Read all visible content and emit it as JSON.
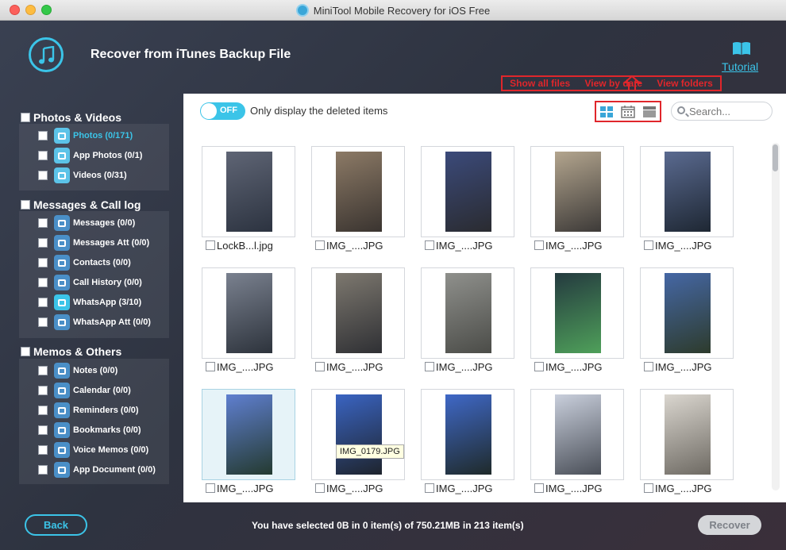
{
  "window": {
    "title": "MiniTool Mobile Recovery for iOS Free"
  },
  "header": {
    "title": "Recover from iTunes Backup File",
    "tutorial_label": "Tutorial",
    "view_tip": {
      "show_all": "Show all files",
      "by_date": "View by date",
      "folders": "View folders"
    }
  },
  "sidebar": {
    "categories": [
      {
        "label": "Photos & Videos",
        "items": [
          {
            "label": "Photos (0/171)",
            "icon": "photo-icon",
            "color": "#5cc3e8",
            "active": true
          },
          {
            "label": "App Photos (0/1)",
            "icon": "app-photo-icon",
            "color": "#5cc3e8"
          },
          {
            "label": "Videos (0/31)",
            "icon": "video-icon",
            "color": "#5cc3e8"
          }
        ]
      },
      {
        "label": "Messages & Call log",
        "items": [
          {
            "label": "Messages (0/0)",
            "icon": "message-icon",
            "color": "#4a8fc7"
          },
          {
            "label": "Messages Att (0/0)",
            "icon": "message-attachment-icon",
            "color": "#4a8fc7"
          },
          {
            "label": "Contacts (0/0)",
            "icon": "contacts-icon",
            "color": "#4a8fc7"
          },
          {
            "label": "Call History (0/0)",
            "icon": "call-history-icon",
            "color": "#4a8fc7"
          },
          {
            "label": "WhatsApp (3/10)",
            "icon": "whatsapp-icon",
            "color": "#3bc4e8"
          },
          {
            "label": "WhatsApp Att (0/0)",
            "icon": "whatsapp-attachment-icon",
            "color": "#4a8fc7"
          }
        ]
      },
      {
        "label": "Memos & Others",
        "items": [
          {
            "label": "Notes (0/0)",
            "icon": "notes-icon",
            "color": "#4a8fc7"
          },
          {
            "label": "Calendar (0/0)",
            "icon": "calendar-icon",
            "color": "#4a8fc7"
          },
          {
            "label": "Reminders (0/0)",
            "icon": "reminders-icon",
            "color": "#4a8fc7"
          },
          {
            "label": "Bookmarks (0/0)",
            "icon": "bookmarks-icon",
            "color": "#4a8fc7"
          },
          {
            "label": "Voice Memos (0/0)",
            "icon": "voice-memos-icon",
            "color": "#4a8fc7"
          },
          {
            "label": "App Document (0/0)",
            "icon": "app-document-icon",
            "color": "#4a8fc7"
          }
        ]
      }
    ]
  },
  "toolbar": {
    "toggle_label": "OFF",
    "only_deleted_label": "Only display the deleted items",
    "search_placeholder": "Search..."
  },
  "thumbnails": [
    {
      "name": "LockB...l.jpg",
      "colors": [
        "#5f6575",
        "#2c3340"
      ]
    },
    {
      "name": "IMG_....JPG",
      "colors": [
        "#8c7a66",
        "#3a3430"
      ]
    },
    {
      "name": "IMG_....JPG",
      "colors": [
        "#3b4a7a",
        "#2a2b30"
      ]
    },
    {
      "name": "IMG_....JPG",
      "colors": [
        "#b3a58e",
        "#3d3a38"
      ]
    },
    {
      "name": "IMG_....JPG",
      "colors": [
        "#5a6a90",
        "#1e2733"
      ]
    },
    {
      "name": "IMG_....JPG",
      "colors": [
        "#7a818f",
        "#2d333c"
      ]
    },
    {
      "name": "IMG_....JPG",
      "colors": [
        "#7d786f",
        "#2f3034"
      ]
    },
    {
      "name": "IMG_....JPG",
      "colors": [
        "#8f908c",
        "#4b4c48"
      ]
    },
    {
      "name": "IMG_....JPG",
      "colors": [
        "#243a3f",
        "#4fa05a"
      ]
    },
    {
      "name": "IMG_....JPG",
      "colors": [
        "#4567a5",
        "#2d3b2c"
      ]
    },
    {
      "name": "IMG_....JPG",
      "colors": [
        "#5f7fd0",
        "#243a30"
      ]
    },
    {
      "name": "IMG_....JPG",
      "colors": [
        "#3a64c2",
        "#1e242d"
      ]
    },
    {
      "name": "IMG_....JPG",
      "colors": [
        "#3f68c7",
        "#1f2a2a"
      ]
    },
    {
      "name": "IMG_....JPG",
      "colors": [
        "#c9cfdc",
        "#4a4f58"
      ]
    },
    {
      "name": "IMG_....JPG",
      "colors": [
        "#dad6cf",
        "#6e6a63"
      ]
    }
  ],
  "tooltip": "IMG_0179.JPG",
  "footer": {
    "back_label": "Back",
    "status": "You have selected 0B in 0 item(s) of 750.21MB in 213 item(s)",
    "recover_label": "Recover"
  },
  "colors": {
    "accent": "#3bc4e8",
    "highlight_red": "#e0262b"
  }
}
